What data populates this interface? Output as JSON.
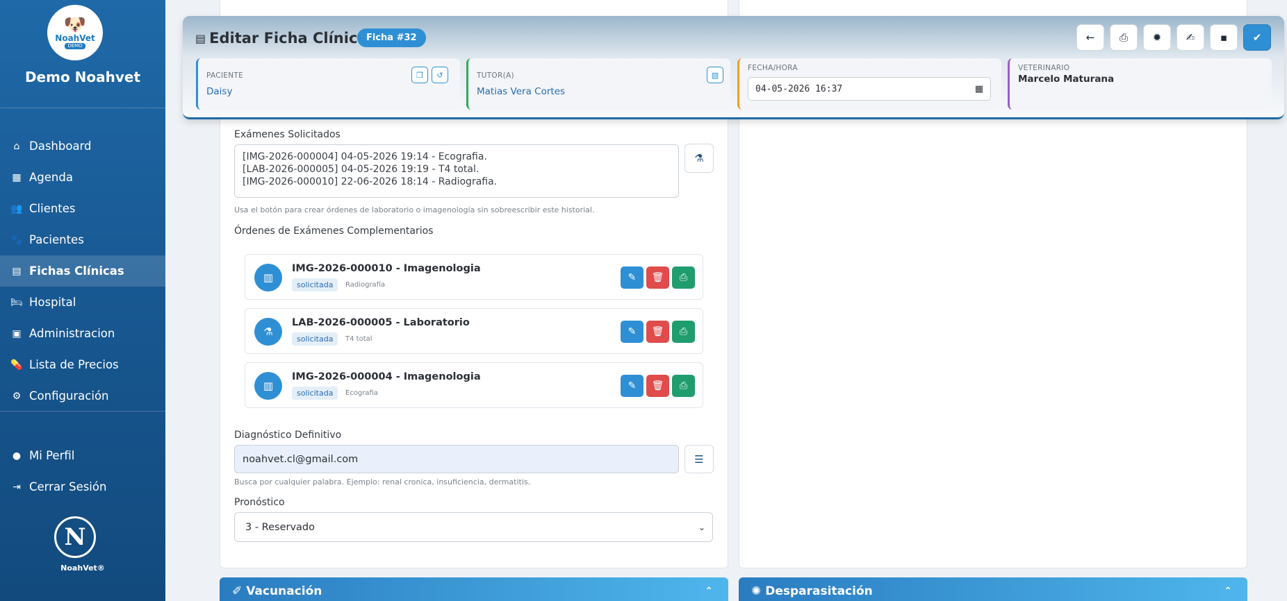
{
  "sidebar": {
    "logo": {
      "text": "NoahVet",
      "sub": "DEMO"
    },
    "brand": "Demo Noahvet",
    "items": [
      {
        "label": "Dashboard",
        "icon": "home-icon"
      },
      {
        "label": "Agenda",
        "icon": "calendar-icon"
      },
      {
        "label": "Clientes",
        "icon": "users-icon"
      },
      {
        "label": "Pacientes",
        "icon": "paw-icon"
      },
      {
        "label": "Fichas Clínicas",
        "icon": "file-medical-icon",
        "active": true
      },
      {
        "label": "Hospital",
        "icon": "hospital-bed-icon"
      },
      {
        "label": "Administracion",
        "icon": "boxes-icon"
      },
      {
        "label": "Lista de Precios",
        "icon": "pills-icon"
      },
      {
        "label": "Configuración",
        "icon": "gear-icon"
      }
    ],
    "profile": "Mi Perfil",
    "logout": "Cerrar Sesión",
    "footer_brand": "NoahVet®"
  },
  "header": {
    "title": "Editar Ficha Clínica",
    "badge": "Ficha #32",
    "toolbar": [
      "back-icon",
      "print-icon",
      "certificate-icon",
      "file-signature-icon",
      "save-icon",
      "check-circle-icon"
    ],
    "patient": {
      "caption": "PACIENTE",
      "value": "Daisy"
    },
    "tutor": {
      "caption": "TUTOR(A)",
      "value": "Matias Vera Cortes"
    },
    "datetime": {
      "caption": "FECHA/HORA",
      "value": "04-05-2026 16:37"
    },
    "vet": {
      "caption": "VETERINARIO",
      "value": "Marcelo Maturana"
    }
  },
  "exams": {
    "label": "Exámenes Solicitados",
    "lines": [
      "[IMG-2026-000004] 04-05-2026 19:14 - Ecografia.",
      "[LAB-2026-000005] 04-05-2026 19:19 - T4 total.",
      "[IMG-2026-000010] 22-06-2026 18:14 - Radiografia."
    ],
    "helper": "Usa el botón para crear órdenes de laboratorio o imagenología sin sobreescribir este historial."
  },
  "orders": {
    "label": "Órdenes de Exámenes Complementarios",
    "items": [
      {
        "title": "IMG-2026-000010 - Imagenologia",
        "status": "solicitada",
        "type": "Radiografía",
        "icon": "xray-icon"
      },
      {
        "title": "LAB-2026-000005 - Laboratorio",
        "status": "solicitada",
        "type": "T4 total",
        "icon": "flask-icon"
      },
      {
        "title": "IMG-2026-000004 - Imagenologia",
        "status": "solicitada",
        "type": "Ecografia",
        "icon": "xray-icon"
      }
    ]
  },
  "diagnosis": {
    "label": "Diagnóstico Definitivo",
    "value": "noahvet.cl@gmail.com",
    "helper": "Busca por cualquier palabra. Ejemplo: renal cronica, insuficiencia, dermatitis."
  },
  "prognosis": {
    "label": "Pronóstico",
    "value": "3 - Reservado"
  },
  "sections": {
    "vaccination": "Vacunación",
    "deworming": "Desparasitación"
  },
  "colors": {
    "primary": "#2f8fd4",
    "sidebar": "#17568f",
    "danger": "#e04b4b",
    "success": "#1f9d6f"
  }
}
